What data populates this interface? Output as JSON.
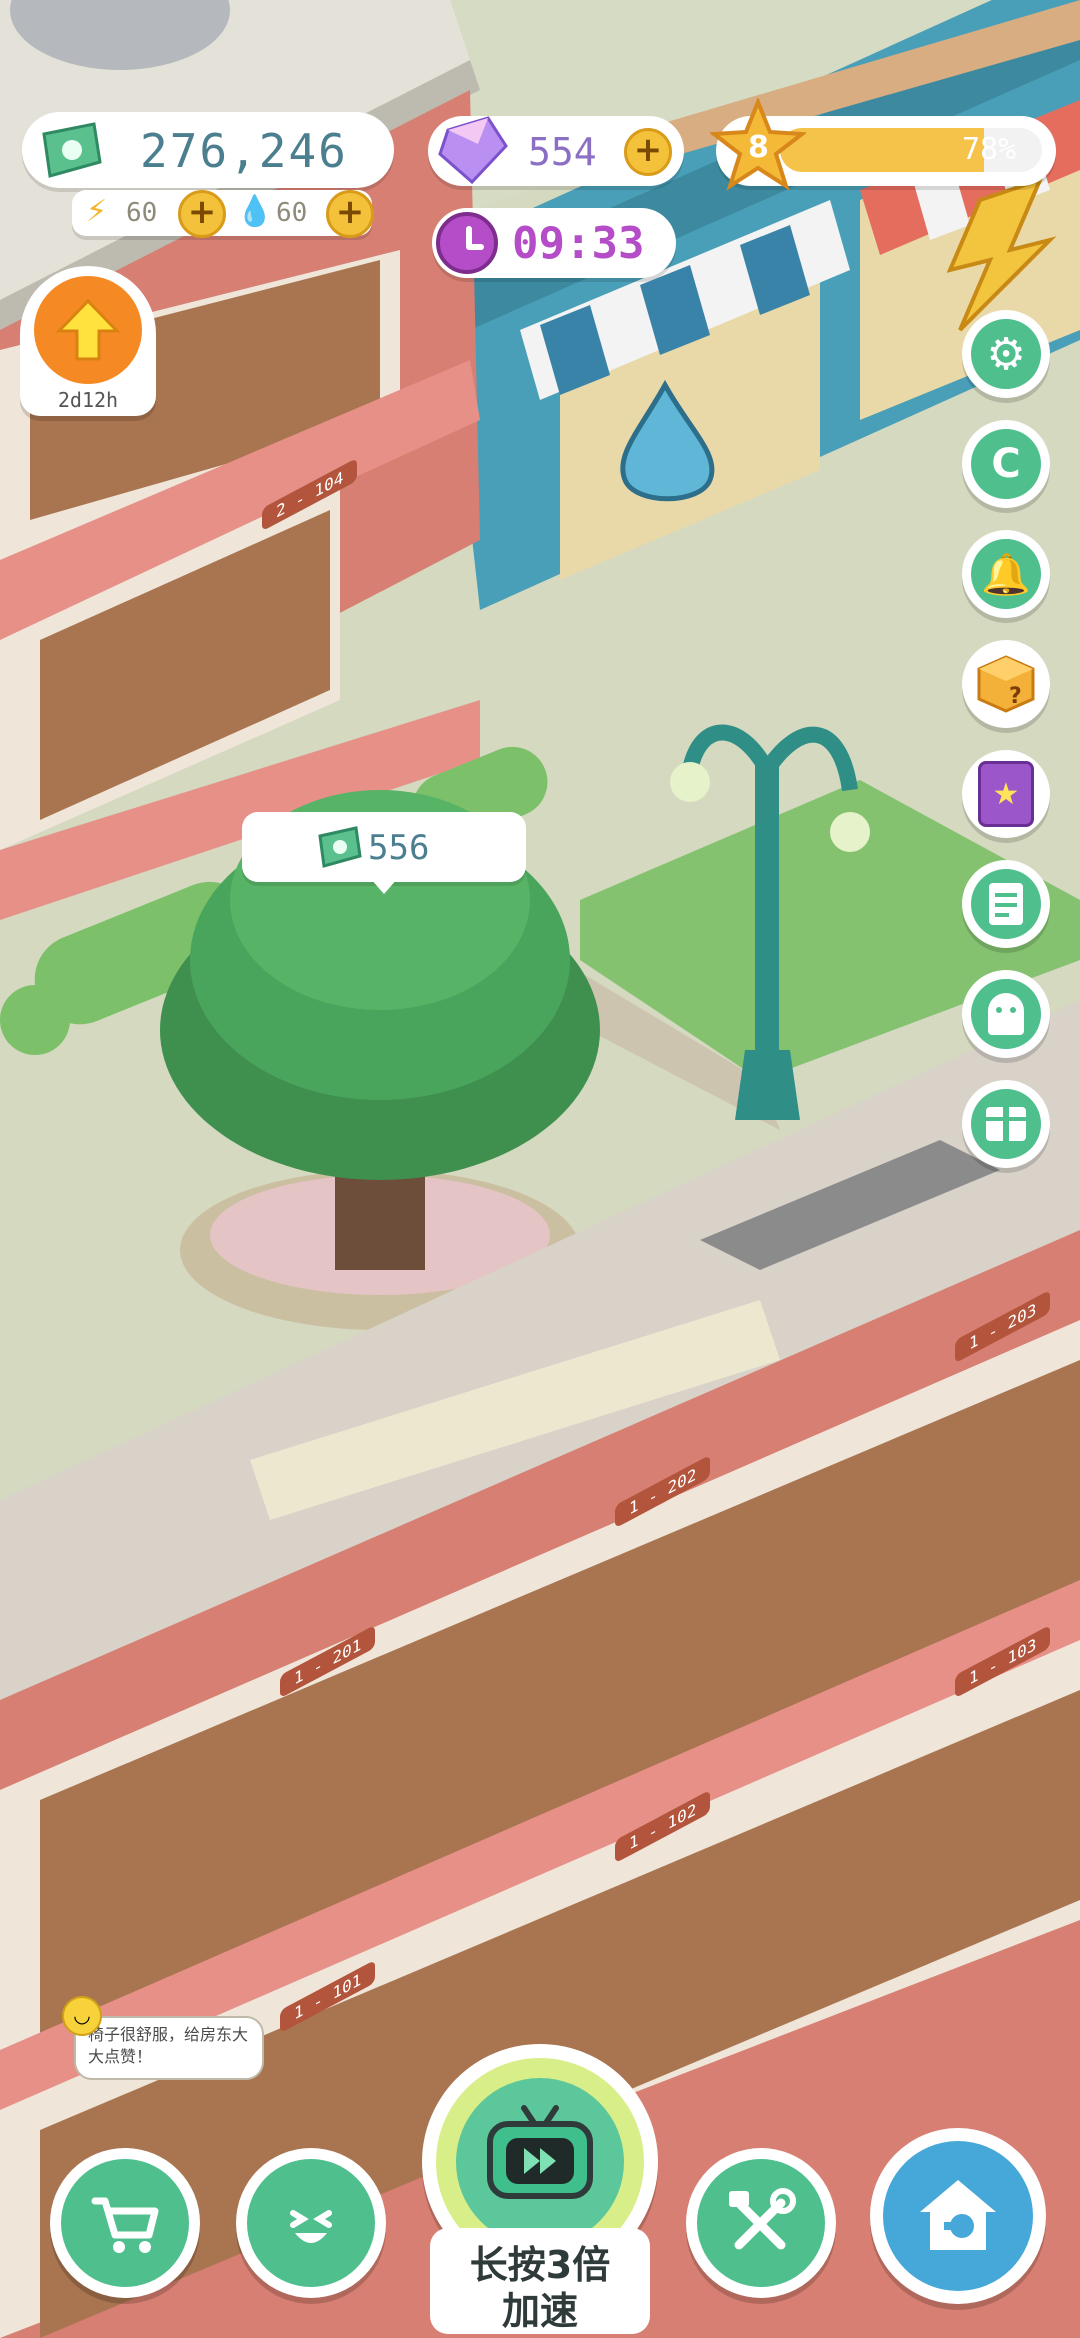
{
  "currency": {
    "cash": "276,246",
    "energy": "60",
    "water": "60",
    "gems": "554",
    "timer": "09:33"
  },
  "level": {
    "number": "8",
    "progress_text": "78%",
    "progress_value": 78
  },
  "upgrade": {
    "time_left": "2d12h"
  },
  "tree_bubble": {
    "amount": "556"
  },
  "rooms": {
    "r2_104": "2 - 104",
    "r1_203": "1 - 203",
    "r1_202": "1 - 202",
    "r1_201": "1 - 201",
    "r1_103": "1 - 103",
    "r1_102": "1 - 102",
    "r1_101": "1 - 101"
  },
  "tenant_speech": "椅子很舒服，给房东大大点赞！",
  "speed_button": {
    "line1": "长按3倍",
    "line2": "加速"
  },
  "side_buttons": [
    "gear-icon",
    "coupon-icon",
    "bell-icon",
    "mystery-box-icon",
    "star-book-icon",
    "notes-icon",
    "ghost-icon",
    "gift-icon"
  ],
  "bottom_buttons": [
    "cart-icon",
    "smile-icon",
    "tv-speed-icon",
    "tools-icon",
    "home-icon"
  ],
  "colors": {
    "accent_green": "#4fbf8e",
    "gold": "#f4c23a",
    "purple": "#b54dc9"
  }
}
